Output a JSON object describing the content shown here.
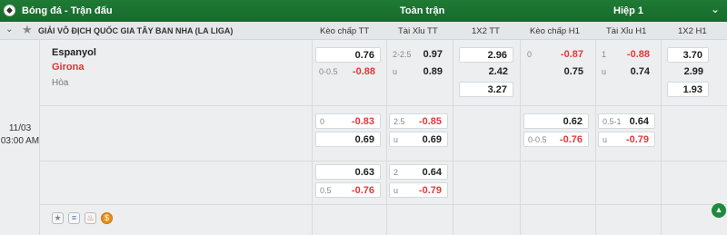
{
  "topbar": {
    "title": "Bóng đá - Trận đấu",
    "full_label": "Toàn trận",
    "half_label": "Hiệp 1",
    "chevron": "⌄"
  },
  "header": {
    "league": "GIẢI VÔ ĐỊCH QUỐC GIA TÂY BAN NHA (LA LIGA)",
    "cols": [
      "Kèo chấp TT",
      "Tài Xỉu TT",
      "1X2 TT",
      "Kèo chấp H1",
      "Tài Xỉu H1",
      "1X2 H1"
    ]
  },
  "match": {
    "home": "Espanyol",
    "away": "Girona",
    "draw": "Hòa",
    "date": "11/03",
    "time": "03:00 AM"
  },
  "odds": {
    "r1": {
      "ah_tt": [
        {
          "line": "",
          "odd": "0.76"
        },
        {
          "line": "0-0.5",
          "odd": "-0.88"
        }
      ],
      "ou_tt": [
        {
          "line": "2-2.5",
          "odd": "0.97"
        },
        {
          "line": "u",
          "odd": "0.89"
        }
      ],
      "x12_tt": [
        "2.96",
        "2.42",
        "3.27"
      ],
      "ah_h1": [
        {
          "line": "0",
          "odd": "-0.87"
        },
        {
          "line": "",
          "odd": "0.75"
        }
      ],
      "ou_h1": [
        {
          "line": "1",
          "odd": "-0.88"
        },
        {
          "line": "u",
          "odd": "0.74"
        }
      ],
      "x12_h1": [
        "3.70",
        "2.99",
        "1.93"
      ]
    },
    "r2": {
      "ah_tt": [
        {
          "line": "0",
          "odd": "-0.83"
        },
        {
          "line": "",
          "odd": "0.69"
        }
      ],
      "ou_tt": [
        {
          "line": "2.5",
          "odd": "-0.85"
        },
        {
          "line": "u",
          "odd": "0.69"
        }
      ],
      "ah_h1": [
        {
          "line": "",
          "odd": "0.62"
        },
        {
          "line": "0-0.5",
          "odd": "-0.76"
        }
      ],
      "ou_h1": [
        {
          "line": "0.5-1",
          "odd": "0.64"
        },
        {
          "line": "u",
          "odd": "-0.79"
        }
      ]
    },
    "r3": {
      "ah_tt": [
        {
          "line": "",
          "odd": "0.63"
        },
        {
          "line": "0.5",
          "odd": "-0.76"
        }
      ],
      "ou_tt": [
        {
          "line": "2",
          "odd": "0.64"
        },
        {
          "line": "u",
          "odd": "-0.79"
        }
      ]
    }
  },
  "icons": [
    "star-icon",
    "stats-icon",
    "fire-icon",
    "money-icon"
  ],
  "colors": {
    "brand_green": "#1f7a35",
    "negative": "#e03b3b",
    "away_team": "#d33"
  }
}
